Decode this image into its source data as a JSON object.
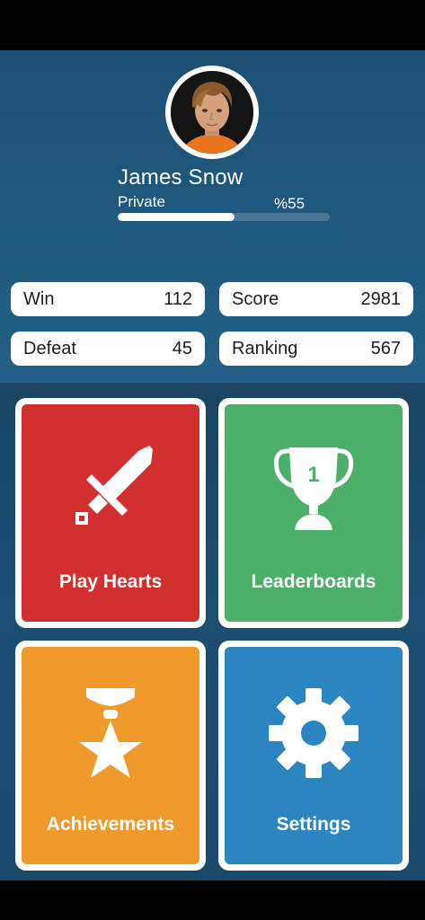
{
  "profile": {
    "name": "James Snow",
    "rank": "Private",
    "progress_label": "%55",
    "progress": 0.55
  },
  "stats": {
    "win": {
      "label": "Win",
      "value": "112"
    },
    "score": {
      "label": "Score",
      "value": "2981"
    },
    "defeat": {
      "label": "Defeat",
      "value": "45"
    },
    "ranking": {
      "label": "Ranking",
      "value": "567"
    }
  },
  "menu": {
    "play": {
      "label": "Play Hearts",
      "color": "#d1302f",
      "icon": "sword-icon"
    },
    "leaderboards": {
      "label": "Leaderboards",
      "color": "#4caf6a",
      "icon": "trophy-icon"
    },
    "trophy_number": "1",
    "achievements": {
      "label": "Achievements",
      "color": "#f09a2b",
      "icon": "medal-icon"
    },
    "settings": {
      "label": "Settings",
      "color": "#2a85c0",
      "icon": "gear-icon"
    }
  }
}
